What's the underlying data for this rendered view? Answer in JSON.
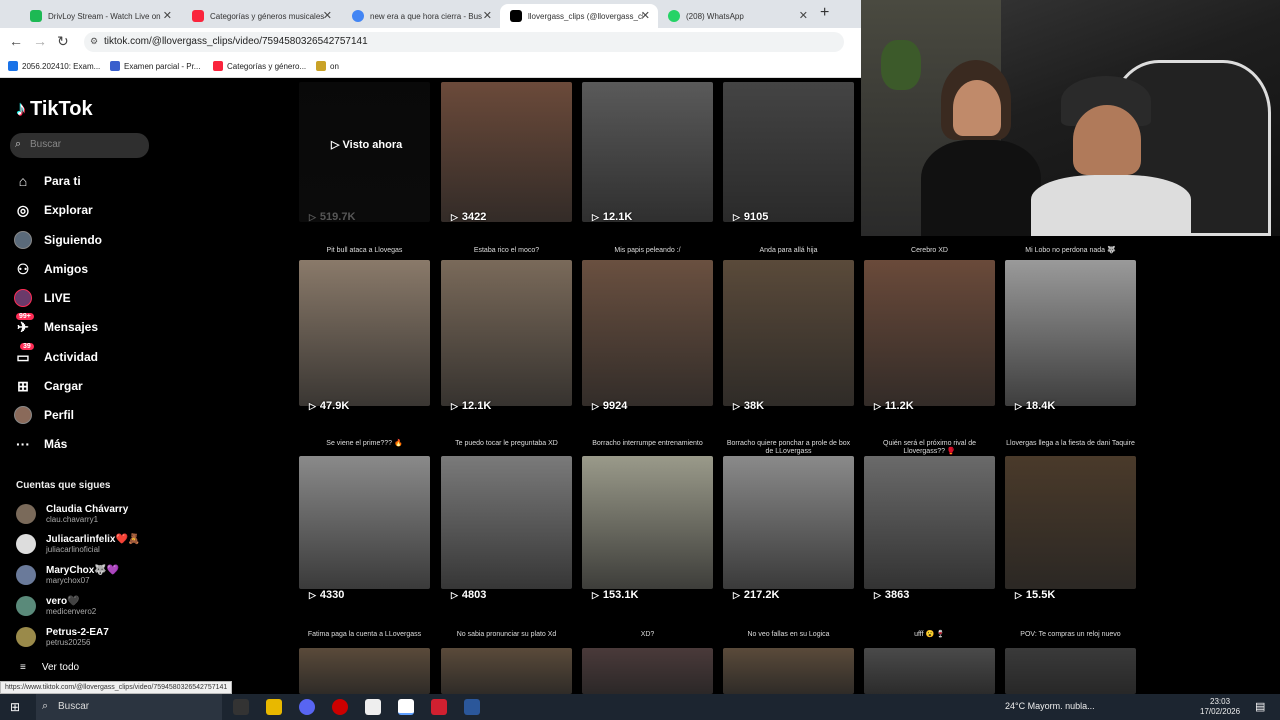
{
  "browser": {
    "tabs": [
      {
        "title": "DrivLoy Stream - Watch Live on",
        "color": "#1db954"
      },
      {
        "title": "Categorías y géneros musicales",
        "color": "#fa243c"
      },
      {
        "title": "new era a que hora cierra - Bus",
        "color": "#4285f4"
      },
      {
        "title": "llovergass_clips (@llovergass_cl",
        "color": "#000000"
      },
      {
        "title": "(208) WhatsApp",
        "color": "#25d366"
      }
    ],
    "url": "tiktok.com/@llovergass_clips/video/7594580326542757141",
    "bookmarks": [
      "2056.202410: Exam...",
      "Examen parcial - Pr...",
      "Categorías y género...",
      "on"
    ]
  },
  "sidebar": {
    "brand": "TikTok",
    "search_placeholder": "Buscar",
    "nav": [
      {
        "label": "Para ti",
        "icon": "home-icon"
      },
      {
        "label": "Explorar",
        "icon": "compass-icon"
      },
      {
        "label": "Siguiendo",
        "icon": "following-avatar-icon"
      },
      {
        "label": "Amigos",
        "icon": "friends-icon"
      },
      {
        "label": "LIVE",
        "icon": "live-icon"
      },
      {
        "label": "Mensajes",
        "icon": "messages-icon",
        "badge": "99+"
      },
      {
        "label": "Actividad",
        "icon": "activity-icon",
        "badge": "39"
      },
      {
        "label": "Cargar",
        "icon": "upload-icon"
      },
      {
        "label": "Perfil",
        "icon": "profile-icon"
      },
      {
        "label": "Más",
        "icon": "more-icon"
      }
    ],
    "following_title": "Cuentas que sigues",
    "accounts": [
      {
        "name": "Claudia Chávarry",
        "handle": "clau.chavarry1"
      },
      {
        "name": "Juliacarlinfelix❤️🧸",
        "handle": "juliacarlinoficial"
      },
      {
        "name": "MaryChox🐺💜",
        "handle": "marychox07"
      },
      {
        "name": "vero🖤",
        "handle": "medicenvero2"
      },
      {
        "name": "Petrus-2-EA7",
        "handle": "petrus20256"
      }
    ],
    "see_all": "Ver todo"
  },
  "grid": {
    "watched_label": "Visto ahora",
    "rows": [
      [
        {
          "caption": "",
          "views": "519.7K",
          "tone": "#1a1a1a"
        },
        {
          "caption": "",
          "views": "3422",
          "tone": "#6b4a3a"
        },
        {
          "caption": "",
          "views": "12.1K",
          "tone": "#5a5a5a"
        },
        {
          "caption": "",
          "views": "9105",
          "tone": "#444444"
        }
      ],
      [
        {
          "caption": "Pit bull ataca a Llovegas",
          "views": "47.9K",
          "tone": "#8a7a6a"
        },
        {
          "caption": "Estaba rico el moco?",
          "views": "12.1K",
          "tone": "#7a6a5a"
        },
        {
          "caption": "Mis papis peleando :/",
          "views": "9924",
          "tone": "#6a5040"
        },
        {
          "caption": "Anda para allá hija",
          "views": "38K",
          "tone": "#5a4a3a"
        },
        {
          "caption": "Cerebro XD",
          "views": "11.2K",
          "tone": "#6a4a3a"
        },
        {
          "caption": "Mi Lobo no perdona nada 🐺",
          "views": "18.4K",
          "tone": "#9a9a9a"
        }
      ],
      [
        {
          "caption": "Se viene el prime??? 🔥",
          "views": "4330",
          "tone": "#8a8a8a"
        },
        {
          "caption": "Te puedo tocar le preguntaba XD",
          "views": "4803",
          "tone": "#7a7a7a"
        },
        {
          "caption": "Borracho interrumpe entrenamiento",
          "views": "153.1K",
          "tone": "#9a9a8a"
        },
        {
          "caption": "Borracho quiere ponchar a prole de box de LLovergass",
          "views": "217.2K",
          "tone": "#8a8a8a"
        },
        {
          "caption": "Quién será el próximo rival de Llovergass?? 🥊",
          "views": "3863",
          "tone": "#6a6a6a"
        },
        {
          "caption": "Llovergas llega a la fiesta de dani Taquire",
          "views": "15.5K",
          "tone": "#4a3a2a"
        }
      ],
      [
        {
          "caption": "Fatima paga la cuenta a LLovergass",
          "views": "",
          "tone": "#5a4a3a"
        },
        {
          "caption": "No sabia pronunciar su plato Xd",
          "views": "",
          "tone": "#5a4a3a"
        },
        {
          "caption": "XD?",
          "views": "",
          "tone": "#4a3a3a"
        },
        {
          "caption": "No veo fallas en su Logica",
          "views": "",
          "tone": "#5a4a3a"
        },
        {
          "caption": "ufff 😮 🍷",
          "views": "",
          "tone": "#4a4a4a"
        },
        {
          "caption": "POV: Te compras un reloj nuevo",
          "views": "",
          "tone": "#3a3a3a"
        }
      ]
    ]
  },
  "status_url": "https://www.tiktok.com/@llovergass_clips/video/7594580326542757141",
  "taskbar": {
    "search": "Buscar",
    "weather": "24°C  Mayorm. nubla...",
    "time": "23:03",
    "date": "17/02/2026"
  }
}
